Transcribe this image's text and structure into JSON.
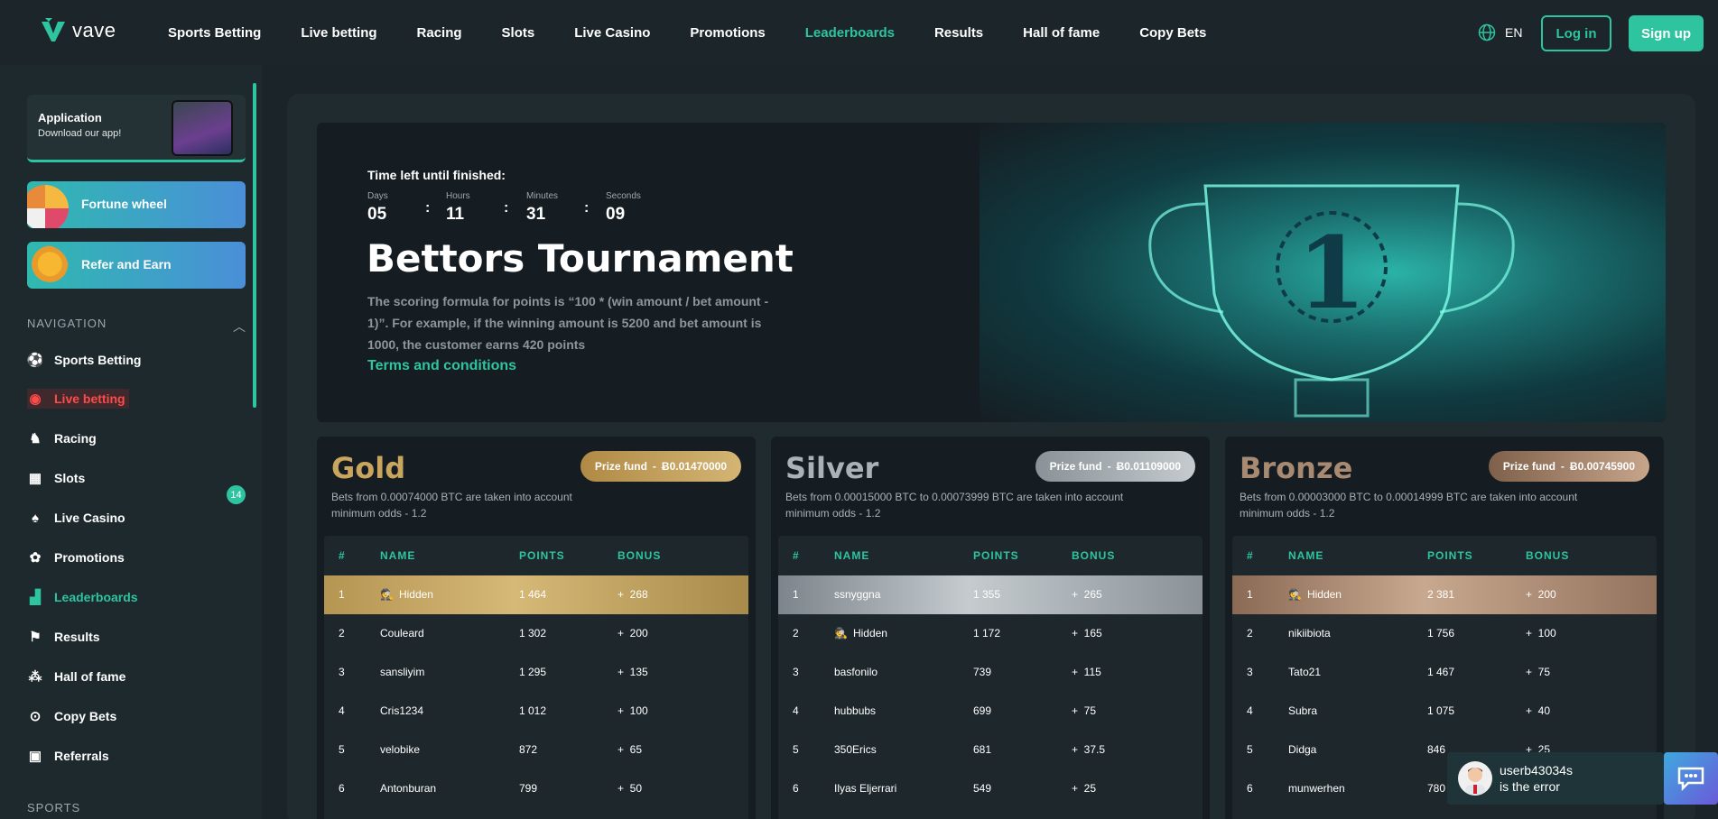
{
  "brand": {
    "logo_text": "vave",
    "accent": "#2ec4a0"
  },
  "header": {
    "nav": [
      {
        "label": "Sports Betting",
        "active": false
      },
      {
        "label": "Live betting",
        "active": false
      },
      {
        "label": "Racing",
        "active": false
      },
      {
        "label": "Slots",
        "active": false
      },
      {
        "label": "Live Casino",
        "active": false
      },
      {
        "label": "Promotions",
        "active": false
      },
      {
        "label": "Leaderboards",
        "active": true
      },
      {
        "label": "Results",
        "active": false
      },
      {
        "label": "Hall of fame",
        "active": false
      },
      {
        "label": "Copy Bets",
        "active": false
      }
    ],
    "language": "EN",
    "login_label": "Log in",
    "signup_label": "Sign up"
  },
  "sidebar": {
    "app_card": {
      "title": "Application",
      "subtitle": "Download our app!"
    },
    "promos": [
      {
        "label": "Fortune wheel"
      },
      {
        "label": "Refer and Earn"
      }
    ],
    "nav_heading": "NAVIGATION",
    "items": [
      {
        "label": "Sports Betting",
        "icon": "soccer-ball-icon"
      },
      {
        "label": "Live betting",
        "icon": "live-signal-icon"
      },
      {
        "label": "Racing",
        "icon": "horse-icon"
      },
      {
        "label": "Slots",
        "icon": "slot-machine-icon"
      },
      {
        "label": "Live Casino",
        "icon": "cards-icon"
      },
      {
        "label": "Promotions",
        "icon": "gift-icon"
      },
      {
        "label": "Leaderboards",
        "icon": "podium-icon"
      },
      {
        "label": "Results",
        "icon": "flag-icon"
      },
      {
        "label": "Hall of fame",
        "icon": "people-icon"
      },
      {
        "label": "Copy Bets",
        "icon": "copy-icon"
      },
      {
        "label": "Referrals",
        "icon": "bag-icon"
      }
    ],
    "promotions_badge": "14",
    "sports_heading": "SPORTS"
  },
  "hero": {
    "time_left_label": "Time left until finished:",
    "countdown": [
      {
        "unit": "Days",
        "value": "05"
      },
      {
        "unit": "Hours",
        "value": "11"
      },
      {
        "unit": "Minutes",
        "value": "31"
      },
      {
        "unit": "Seconds",
        "value": "09"
      }
    ],
    "title": "Bettors Tournament",
    "description": "The scoring formula for points is “100 * (win amount / bet amount - 1)”. For example, if the winning amount is 5200 and bet amount is 1000, the customer earns 420 points",
    "terms_label": "Terms and conditions"
  },
  "columns": {
    "num": "#",
    "name": "NAME",
    "points": "POINTS",
    "bonus": "BONUS"
  },
  "tournaments": [
    {
      "name": "Gold",
      "color": "#c9a65e",
      "prize_label": "Prize fund",
      "prize_value": "Ƀ0.01470000",
      "desc_line1": "Bets from 0.00074000 BTC are taken into account",
      "desc_line2": "minimum odds - 1.2",
      "rows": [
        {
          "num": "1",
          "name": "Hidden",
          "hidden": true,
          "points": "1 464",
          "bonus": "+  268"
        },
        {
          "num": "2",
          "name": "Couleard",
          "points": "1 302",
          "bonus": "+  200"
        },
        {
          "num": "3",
          "name": "sansliyim",
          "points": "1 295",
          "bonus": "+  135"
        },
        {
          "num": "4",
          "name": "Cris1234",
          "points": "1 012",
          "bonus": "+  100"
        },
        {
          "num": "5",
          "name": "velobike",
          "points": "872",
          "bonus": "+  65"
        },
        {
          "num": "6",
          "name": "Antonburan",
          "points": "799",
          "bonus": "+  50"
        }
      ]
    },
    {
      "name": "Silver",
      "color": "#aab2b7",
      "prize_label": "Prize fund",
      "prize_value": "Ƀ0.01109000",
      "desc_line1": "Bets from 0.00015000 BTC to 0.00073999 BTC are taken into account",
      "desc_line2": "minimum odds - 1.2",
      "rows": [
        {
          "num": "1",
          "name": "ssnyggna",
          "points": "1 355",
          "bonus": "+  265"
        },
        {
          "num": "2",
          "name": "Hidden",
          "hidden": true,
          "points": "1 172",
          "bonus": "+  165"
        },
        {
          "num": "3",
          "name": "basfonilo",
          "points": "739",
          "bonus": "+  115"
        },
        {
          "num": "4",
          "name": "hubbubs",
          "points": "699",
          "bonus": "+  75"
        },
        {
          "num": "5",
          "name": "350Erics",
          "points": "681",
          "bonus": "+  37.5"
        },
        {
          "num": "6",
          "name": "Ilyas Eljerrari",
          "points": "549",
          "bonus": "+  25"
        }
      ]
    },
    {
      "name": "Bronze",
      "color": "#a88a72",
      "prize_label": "Prize fund",
      "prize_value": "Ƀ0.00745900",
      "desc_line1": "Bets from 0.00003000 BTC to 0.00014999 BTC are taken into account",
      "desc_line2": "minimum odds - 1.2",
      "rows": [
        {
          "num": "1",
          "name": "Hidden",
          "hidden": true,
          "points": "2 381",
          "bonus": "+  200"
        },
        {
          "num": "2",
          "name": "nikiibiota",
          "points": "1 756",
          "bonus": "+  100"
        },
        {
          "num": "3",
          "name": "Tato21",
          "points": "1 467",
          "bonus": "+  75"
        },
        {
          "num": "4",
          "name": "Subra",
          "points": "1 075",
          "bonus": "+  40"
        },
        {
          "num": "5",
          "name": "Didga",
          "points": "846",
          "bonus": "+  25"
        },
        {
          "num": "6",
          "name": "munwerhen",
          "points": "780",
          "bonus": ""
        }
      ]
    }
  ],
  "chat": {
    "line1": "userb43034s",
    "line2": "is the error"
  }
}
